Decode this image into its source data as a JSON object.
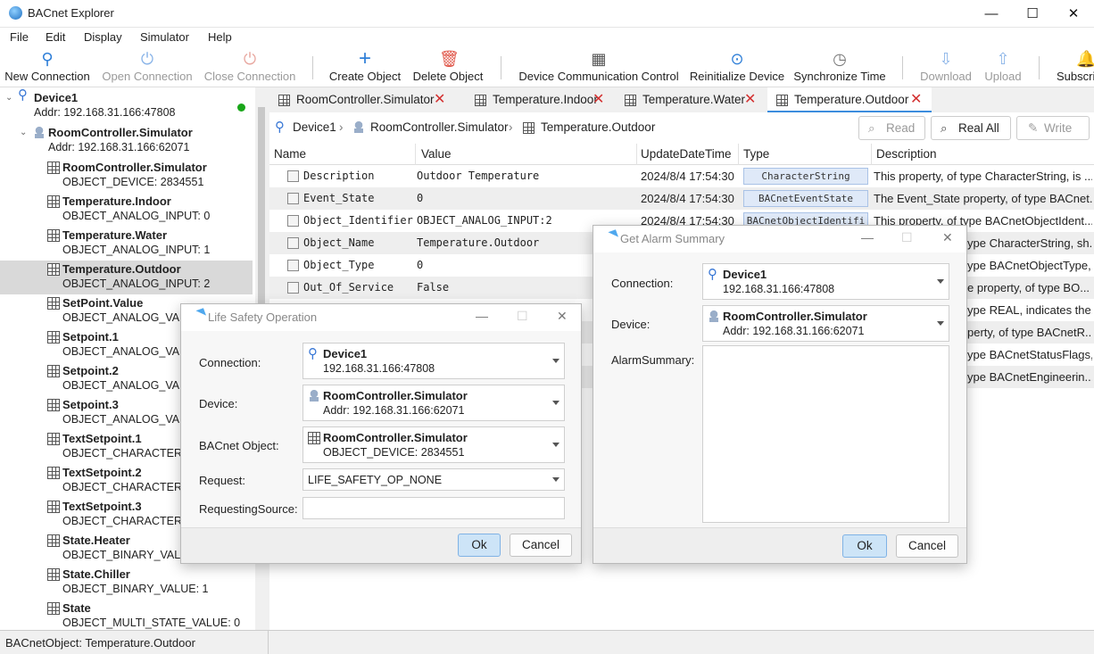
{
  "window": {
    "title": "BACnet Explorer",
    "minimize": "—",
    "maximize": "☐",
    "close": "✕"
  },
  "menu": [
    "File",
    "Edit",
    "Display",
    "Simulator",
    "Help"
  ],
  "toolbar": {
    "new_connection": "New Connection",
    "open_connection": "Open Connection",
    "close_connection": "Close Connection",
    "create_object": "Create Object",
    "delete_object": "Delete Object",
    "device_comm_control": "Device Communication Control",
    "reinitialize_device": "Reinitialize Device",
    "synchronize_time": "Synchronize Time",
    "download": "Download",
    "upload": "Upload",
    "subscribe": "Subscri"
  },
  "tree": {
    "device": {
      "name": "Device1",
      "addr": "Addr:  192.168.31.166:47808"
    },
    "controller": {
      "name": "RoomController.Simulator",
      "addr": "Addr:  192.168.31.166:62071"
    },
    "objects": [
      {
        "name": "RoomController.Simulator",
        "sub": "OBJECT_DEVICE:  2834551"
      },
      {
        "name": "Temperature.Indoor",
        "sub": "OBJECT_ANALOG_INPUT:  0"
      },
      {
        "name": "Temperature.Water",
        "sub": "OBJECT_ANALOG_INPUT:  1"
      },
      {
        "name": "Temperature.Outdoor",
        "sub": "OBJECT_ANALOG_INPUT:  2"
      },
      {
        "name": "SetPoint.Value",
        "sub": "OBJECT_ANALOG_VALU"
      },
      {
        "name": "Setpoint.1",
        "sub": "OBJECT_ANALOG_VALU"
      },
      {
        "name": "Setpoint.2",
        "sub": "OBJECT_ANALOG_VALU"
      },
      {
        "name": "Setpoint.3",
        "sub": "OBJECT_ANALOG_VALU"
      },
      {
        "name": "TextSetpoint.1",
        "sub": "OBJECT_CHARACTERST"
      },
      {
        "name": "TextSetpoint.2",
        "sub": "OBJECT_CHARACTERST"
      },
      {
        "name": "TextSetpoint.3",
        "sub": "OBJECT_CHARACTERST"
      },
      {
        "name": "State.Heater",
        "sub": "OBJECT_BINARY_VALUE"
      },
      {
        "name": "State.Chiller",
        "sub": "OBJECT_BINARY_VALUE:  1"
      },
      {
        "name": "State",
        "sub": "OBJECT_MULTI_STATE_VALUE:  0"
      }
    ]
  },
  "tabs": [
    {
      "label": "RoomController.Simulator"
    },
    {
      "label": "Temperature.Indoor"
    },
    {
      "label": "Temperature.Water"
    },
    {
      "label": "Temperature.Outdoor"
    }
  ],
  "breadcrumb": [
    "Device1",
    "RoomController.Simulator",
    "Temperature.Outdoor"
  ],
  "actions": {
    "read": "Read",
    "read_all": "Real All",
    "write": "Write"
  },
  "table": {
    "headers": [
      "Name",
      "Value",
      "UpdateDateTime",
      "Type",
      "Description"
    ],
    "rows": [
      {
        "name": "Description",
        "value": "Outdoor Temperature",
        "time": "2024/8/4 17:54:30",
        "type": "CharacterString",
        "desc": "This property, of type CharacterString, is ..."
      },
      {
        "name": "Event_State",
        "value": "0",
        "time": "2024/8/4 17:54:30",
        "type": "BACnetEventState",
        "desc": "The Event_State property, of type BACnet..."
      },
      {
        "name": "Object_Identifier",
        "value": "OBJECT_ANALOG_INPUT:2",
        "time": "2024/8/4 17:54:30",
        "type": "BACnetObjectIdentifi",
        "desc": "This property, of type BACnetObjectIdent..."
      },
      {
        "name": "Object_Name",
        "value": "Temperature.Outdoor",
        "time": "",
        "type": "",
        "desc": "ype CharacterString, sh..."
      },
      {
        "name": "Object_Type",
        "value": "0",
        "time": "",
        "type": "",
        "desc": "ype BACnetObjectType,..."
      },
      {
        "name": "Out_Of_Service",
        "value": "False",
        "time": "",
        "type": "",
        "desc": "e property, of type BO..."
      },
      {
        "name": "",
        "value": "",
        "time": "",
        "type": "",
        "desc": "ype REAL, indicates the..."
      },
      {
        "name": "",
        "value": "",
        "time": "",
        "type": "",
        "desc": "perty, of type BACnetR..."
      },
      {
        "name": "",
        "value": "",
        "time": "",
        "type": "",
        "desc": "ype BACnetStatusFlags,..."
      },
      {
        "name": "",
        "value": "",
        "time": "",
        "type": "",
        "desc": "ype BACnetEngineerin..."
      }
    ]
  },
  "status": "BACnetObject: Temperature.Outdoor",
  "life_safety": {
    "title": "Life Safety Operation",
    "connection_label": "Connection:",
    "connection_name": "Device1",
    "connection_addr": "192.168.31.166:47808",
    "device_label": "Device:",
    "device_name": "RoomController.Simulator",
    "device_addr": "Addr:  192.168.31.166:62071",
    "object_label": "BACnet Object:",
    "object_name": "RoomController.Simulator",
    "object_sub": "OBJECT_DEVICE:  2834551",
    "request_label": "Request:",
    "request_value": "LIFE_SAFETY_OP_NONE",
    "source_label": "RequestingSource:",
    "source_value": "",
    "ok": "Ok",
    "cancel": "Cancel"
  },
  "alarm_summary": {
    "title": "Get Alarm Summary",
    "connection_label": "Connection:",
    "connection_name": "Device1",
    "connection_addr": "192.168.31.166:47808",
    "device_label": "Device:",
    "device_name": "RoomController.Simulator",
    "device_addr": "Addr:  192.168.31.166:62071",
    "summary_label": "AlarmSummary:",
    "ok": "Ok",
    "cancel": "Cancel"
  }
}
